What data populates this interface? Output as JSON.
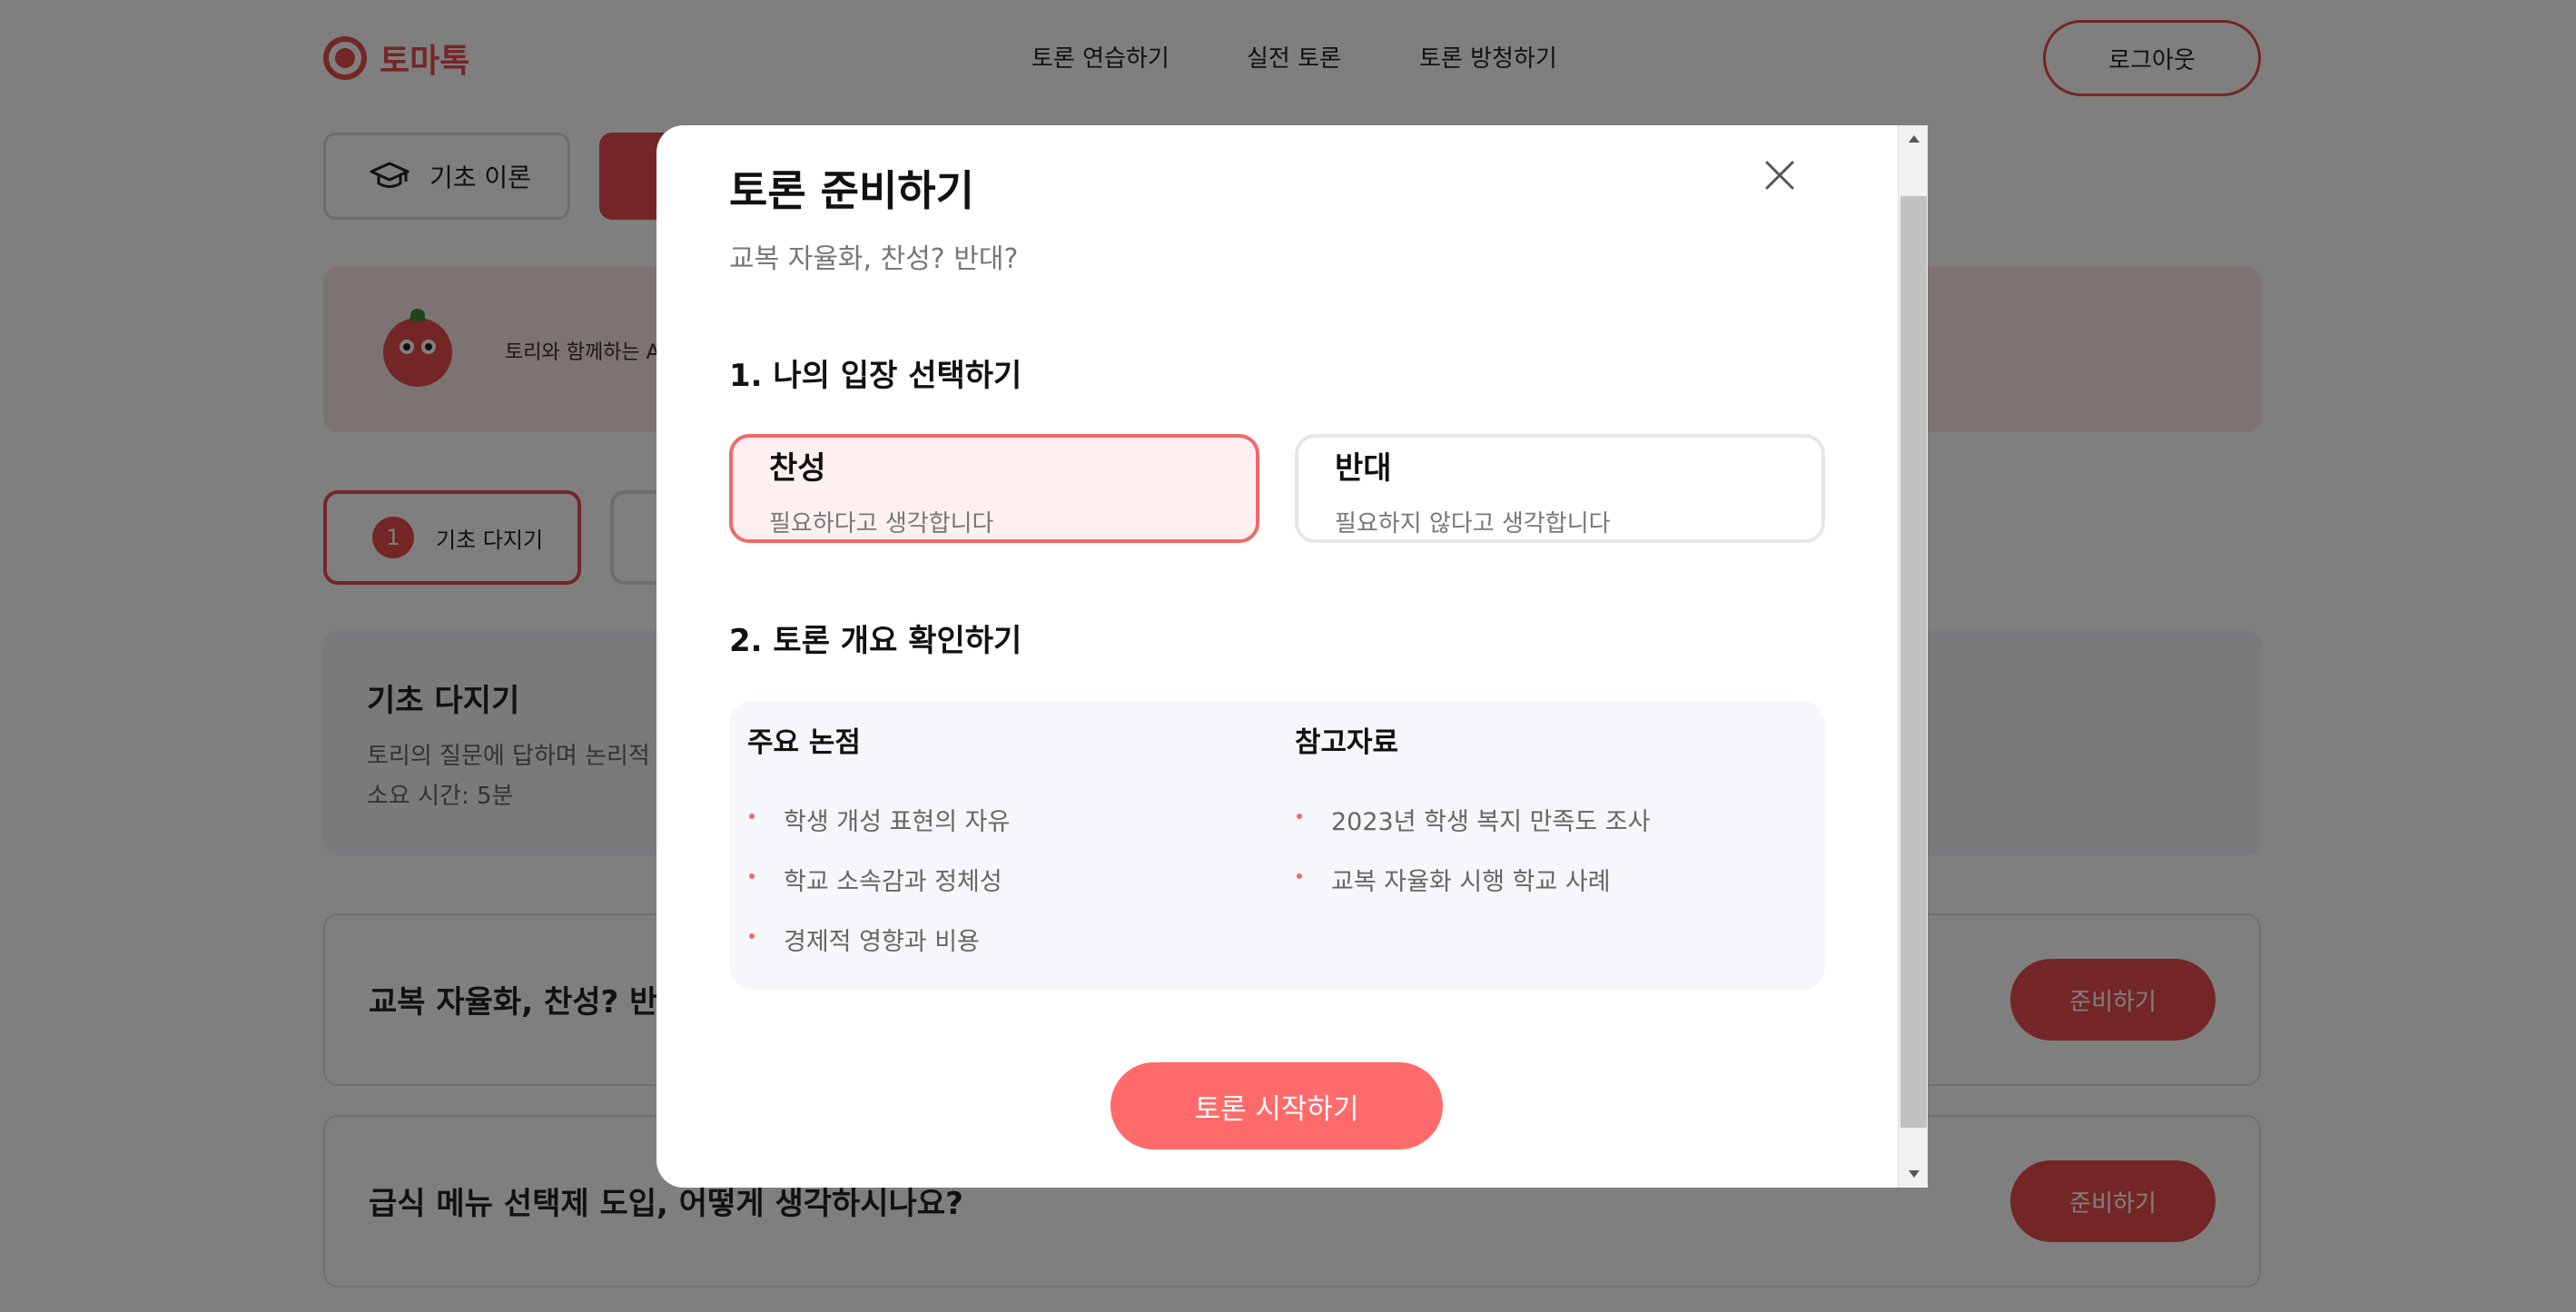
{
  "header": {
    "logo_text": "토마톡",
    "nav": [
      "토론 연습하기",
      "실전 토론",
      "토론 방청하기"
    ],
    "logout_label": "로그아웃"
  },
  "tabs": {
    "theory_label": "기초 이론"
  },
  "banner": {
    "text": "토리와 함께하는 A"
  },
  "steps": {
    "step1_num": "1",
    "step1_label": "기초 다지기"
  },
  "basics": {
    "title": "기초 다지기",
    "desc": "토리의 질문에 답하며 논리적",
    "time": "소요 시간: 5분"
  },
  "topics": [
    {
      "title": "교복 자율화, 찬성? 반대",
      "button": "준비하기"
    },
    {
      "title": "급식 메뉴 선택제 도입, 어떻게 생각하시나요?",
      "button": "준비하기"
    }
  ],
  "modal": {
    "title": "토론 준비하기",
    "subtitle": "교복 자율화, 찬성? 반대?",
    "section1_title": "1. 나의 입장 선택하기",
    "choices": [
      {
        "label": "찬성",
        "desc": "필요하다고 생각합니다",
        "selected": true
      },
      {
        "label": "반대",
        "desc": "필요하지 않다고 생각합니다",
        "selected": false
      }
    ],
    "section2_title": "2. 토론 개요 확인하기",
    "overview": {
      "issues_title": "주요 논점",
      "issues": [
        "학생 개성 표현의 자유",
        "학교 소속감과 정체성",
        "경제적 영향과 비용"
      ],
      "refs_title": "참고자료",
      "refs": [
        "2023년 학생 복지 만족도 조사",
        "교복 자율화 시행 학교 사례"
      ]
    },
    "start_label": "토론 시작하기"
  },
  "colors": {
    "accent": "#e94c4c",
    "selected_border": "#f0696a",
    "selected_bg": "#fff0f0",
    "start_button": "#ff6b6b",
    "overlay": "rgba(0,0,0,0.5)"
  },
  "icons": {
    "logo": "tomato-target-icon",
    "theory": "graduation-cap-icon",
    "close": "close-icon"
  }
}
